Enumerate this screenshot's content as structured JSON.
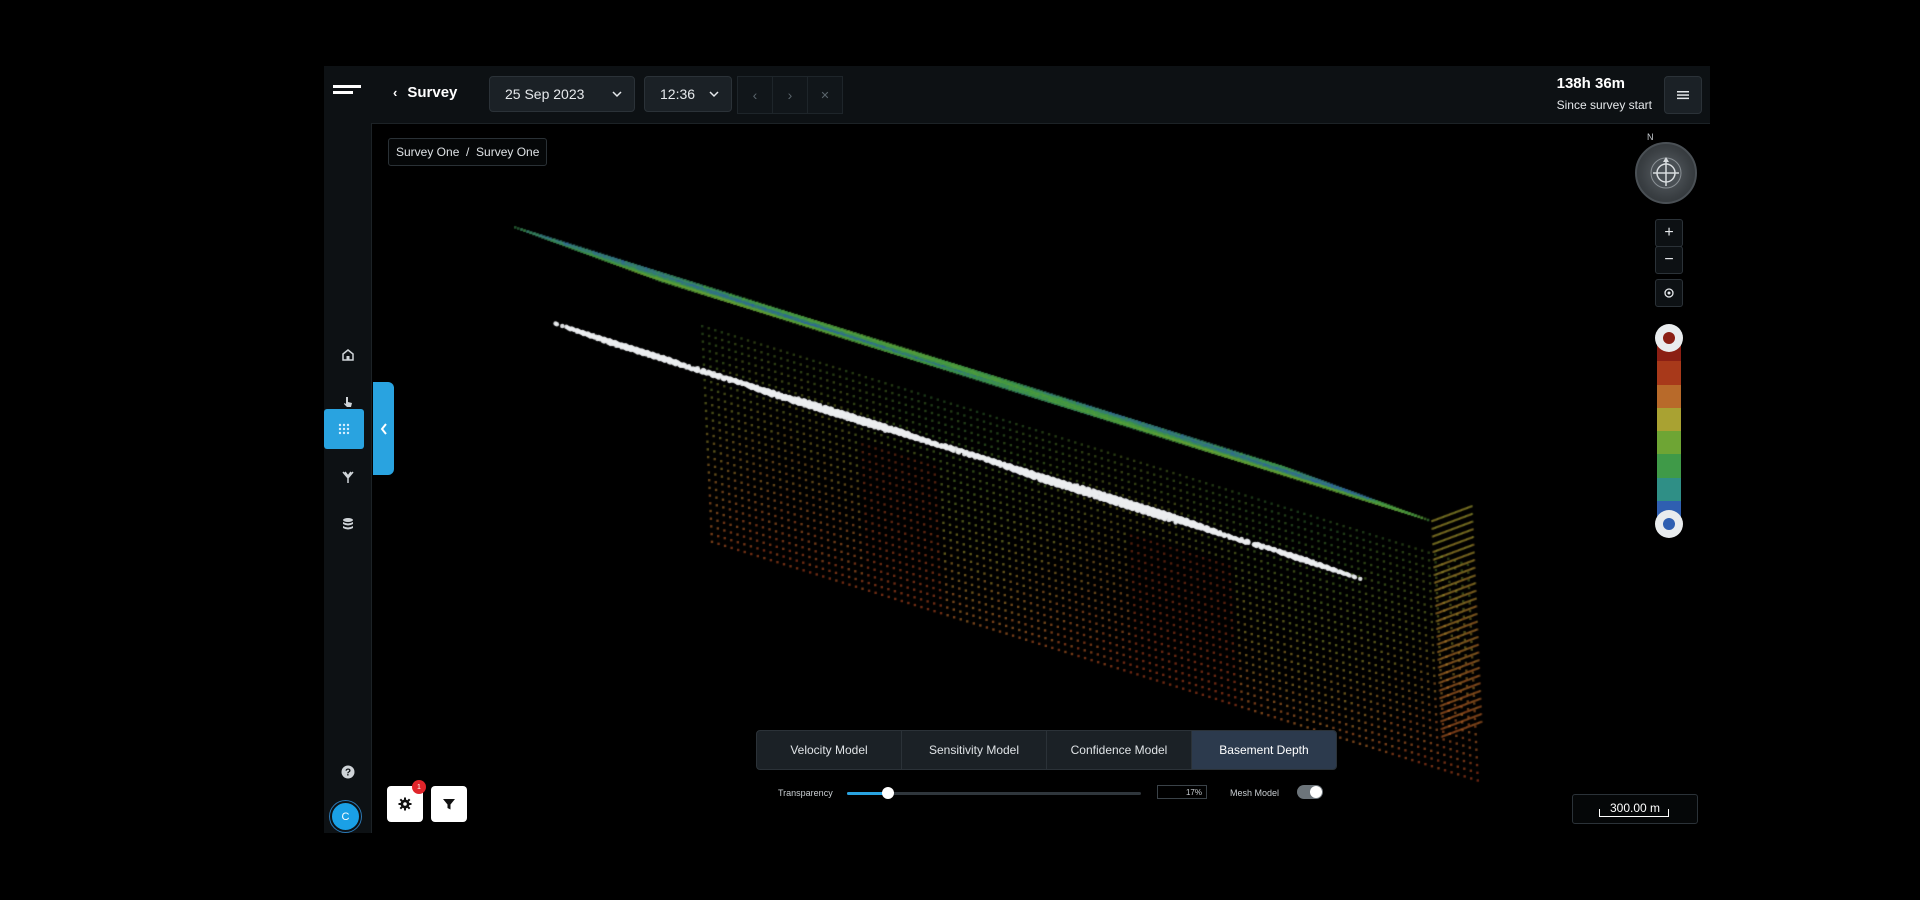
{
  "header": {
    "back_label": "Survey",
    "date_value": "25 Sep 2023",
    "time_value": "12:36",
    "elapsed_value": "138h 36m",
    "elapsed_caption": "Since survey start"
  },
  "breadcrumb": "Survey One  /  Survey One",
  "sidebar": {
    "items": [
      {
        "icon": "home-icon"
      },
      {
        "icon": "pointer-icon"
      },
      {
        "icon": "grid-icon",
        "active": true
      },
      {
        "icon": "antenna-icon"
      },
      {
        "icon": "database-icon"
      }
    ],
    "help_icon": "help-icon",
    "avatar_initial": "C"
  },
  "compass_label": "N",
  "tabs": [
    {
      "label": "Velocity Model",
      "active": false
    },
    {
      "label": "Sensitivity Model",
      "active": false
    },
    {
      "label": "Confidence Model",
      "active": false
    },
    {
      "label": "Basement Depth",
      "active": true
    }
  ],
  "controls": {
    "transparency_label": "Transparency",
    "transparency_value": "17%",
    "transparency_fraction": 0.14,
    "mesh_label": "Mesh Model",
    "mesh_on": true
  },
  "scale_label": "300.00 m",
  "settings_badge": "1",
  "colors": {
    "accent": "#29a3e0",
    "legend": [
      "#8b1f14",
      "#a8391a",
      "#b86a2a",
      "#a9a232",
      "#6ea534",
      "#3f9a48",
      "#2f8f86",
      "#2f5fb1"
    ]
  }
}
